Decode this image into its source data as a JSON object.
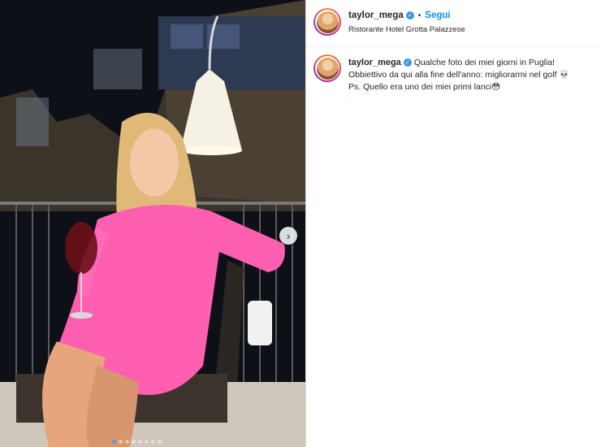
{
  "post": {
    "author": "taylor_mega",
    "verified": true,
    "follow_label": "Segui",
    "separator": "•",
    "location": "Ristorante Hotel Grotta Palazzese",
    "caption_line1": "Qualche foto dei miei giorni in Puglia!",
    "caption_line2": "Obbiettivo da qui alla fine dell'anno: migliorarmi nel golf 💀",
    "caption_line3": "Ps. Quello era uno dei miei primi lanci😳",
    "time_label": "·",
    "carousel": {
      "slide_count": 8,
      "active_index": 0,
      "next_icon": "chevron-right-icon"
    }
  },
  "colors": {
    "follow": "#0095f6",
    "verified": "#3897f0",
    "dress": "#ff5fb0",
    "active_dot": "#4f9cf3"
  }
}
